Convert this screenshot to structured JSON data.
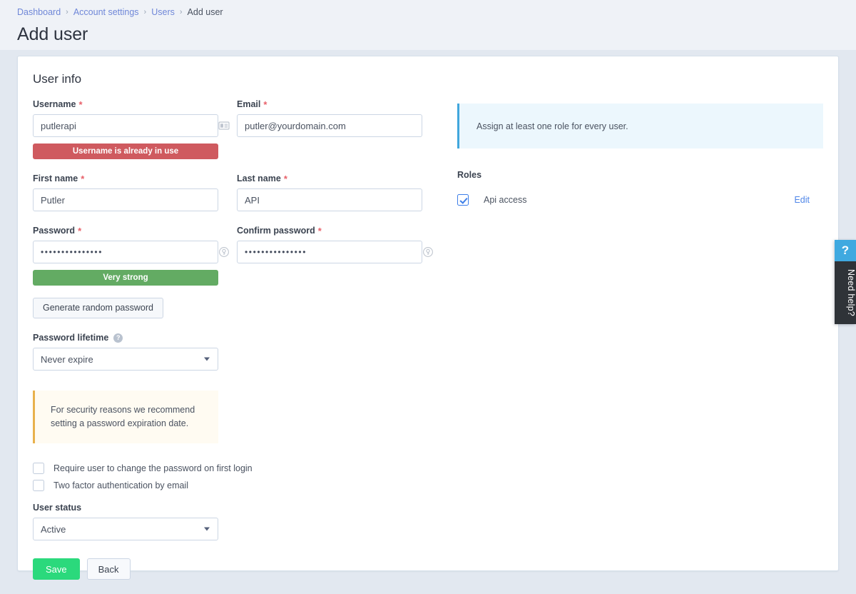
{
  "breadcrumb": {
    "items": [
      {
        "label": "Dashboard",
        "current": false
      },
      {
        "label": "Account settings",
        "current": false
      },
      {
        "label": "Users",
        "current": false
      },
      {
        "label": "Add user",
        "current": true
      }
    ],
    "separator": "›"
  },
  "page": {
    "title": "Add user"
  },
  "card": {
    "title": "User info"
  },
  "form": {
    "username": {
      "label": "Username",
      "required_mark": "*",
      "value": "putlerapi",
      "icon": "contact-card-icon",
      "error": "Username is already in use"
    },
    "email": {
      "label": "Email",
      "required_mark": "*",
      "value": "putler@yourdomain.com"
    },
    "first_name": {
      "label": "First name",
      "required_mark": "*",
      "value": "Putler"
    },
    "last_name": {
      "label": "Last name",
      "required_mark": "*",
      "value": "API"
    },
    "password": {
      "label": "Password",
      "required_mark": "*",
      "value": "•••••••••••••••",
      "icon": "generate-key-icon",
      "strength": "Very strong"
    },
    "confirm_password": {
      "label": "Confirm password",
      "required_mark": "*",
      "value": "•••••••••••••••",
      "icon": "generate-key-icon"
    },
    "generate_password_button": "Generate random password",
    "password_lifetime": {
      "label": "Password lifetime",
      "help_glyph": "?",
      "value": "Never expire"
    },
    "security_notice": "For security reasons we recommend setting a password expiration date.",
    "checkboxes": [
      {
        "label": "Require user to change the password on first login",
        "checked": false
      },
      {
        "label": "Two factor authentication by email",
        "checked": false
      }
    ],
    "user_status": {
      "label": "User status",
      "value": "Active"
    }
  },
  "roles_panel": {
    "info": "Assign at least one role for every user.",
    "title": "Roles",
    "items": [
      {
        "name": "Api access",
        "checked": true,
        "edit_label": "Edit"
      }
    ]
  },
  "footer": {
    "save_label": "Save",
    "back_label": "Back"
  },
  "help_widget": {
    "glyph": "?",
    "label": "Need help?"
  },
  "colors": {
    "page_background": "#e2e8f0",
    "header_background": "#eff2f7",
    "danger": "#cf5a5f",
    "success": "#63ab63",
    "save_green": "#2bd97c",
    "link_blue": "#6f87d8",
    "info_blue": "#41a7dd",
    "warning_orange": "#e8b14c",
    "checkbox_blue": "#3d7ee8"
  }
}
